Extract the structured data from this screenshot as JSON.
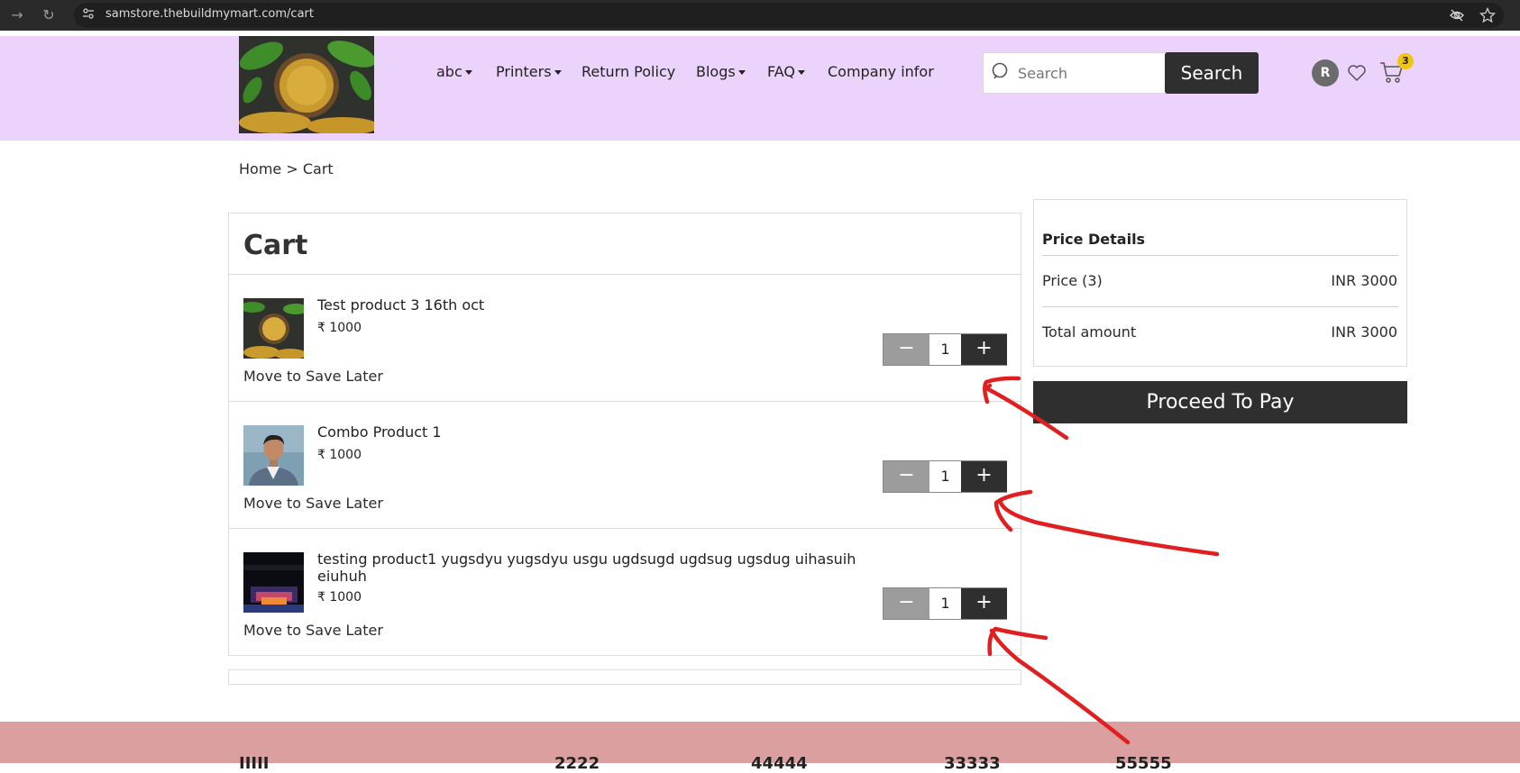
{
  "browser": {
    "url": "samstore.thebuildmymart.com/cart"
  },
  "header": {
    "nav": [
      {
        "label": "abc",
        "dropdown": true
      },
      {
        "label": "Printers",
        "dropdown": true
      },
      {
        "label": "Return Policy",
        "dropdown": false
      },
      {
        "label": "Blogs",
        "dropdown": true
      },
      {
        "label": "FAQ",
        "dropdown": true
      },
      {
        "label": "Company infor",
        "dropdown": false
      }
    ],
    "search": {
      "placeholder": "Search",
      "button_label": "Search"
    },
    "avatar_initial": "R",
    "cart_count": "3"
  },
  "breadcrumb": {
    "home": "Home",
    "separator": ">",
    "current": "Cart"
  },
  "cart": {
    "title": "Cart",
    "items": [
      {
        "name": "Test product 3 16th oct",
        "price": "₹ 1000",
        "save_label": "Move to Save Later",
        "minus": "−",
        "quantity": "1",
        "plus": "+"
      },
      {
        "name": "Combo Product 1",
        "price": "₹ 1000",
        "save_label": "Move to Save Later",
        "minus": "−",
        "quantity": "1",
        "plus": "+"
      },
      {
        "name": "testing product1 yugsdyu yugsdyu usgu ugdsugd ugdsug ugsdug uihasuih eiuhuh",
        "price": "₹ 1000",
        "save_label": "Move to Save Later",
        "minus": "−",
        "quantity": "1",
        "plus": "+"
      }
    ]
  },
  "price_details": {
    "title": "Price Details",
    "price_label": "Price (3)",
    "price_value": "INR 3000",
    "total_label": "Total amount",
    "total_value": "INR 3000",
    "pay_button": "Proceed To Pay"
  },
  "footer": {
    "words": [
      "IIIII",
      "2222",
      "44444",
      "33333",
      "55555"
    ]
  },
  "colors": {
    "header_bg": "#ecd3fc",
    "footer_bg": "#dc9f9f",
    "dark_button": "#2f2f2f",
    "annotation_red": "#e02020"
  }
}
